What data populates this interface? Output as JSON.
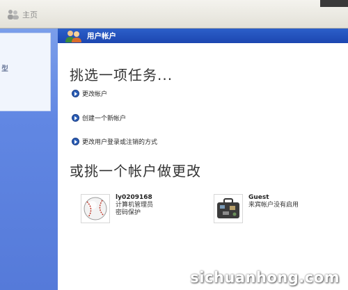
{
  "toolbar": {
    "home_label": "主页"
  },
  "sidebar": {
    "box_label": "型"
  },
  "header": {
    "title": "用户帐户"
  },
  "main": {
    "pick_task_heading": "挑选一项任务...",
    "tasks": [
      {
        "label": "更改帐户"
      },
      {
        "label": "创建一个新帐户"
      },
      {
        "label": "更改用户登录或注销的方式"
      }
    ],
    "pick_account_heading": "或挑一个帐户做更改",
    "accounts": [
      {
        "name": "ly0209168",
        "line1": "计算机管理员",
        "line2": "密码保护",
        "picture_icon": "baseball-icon"
      },
      {
        "name": "Guest",
        "line1": "来宾帐户没有启用",
        "line2": "",
        "picture_icon": "suitcase-icon"
      }
    ]
  },
  "watermark": {
    "text": "sichuanhong.com"
  }
}
